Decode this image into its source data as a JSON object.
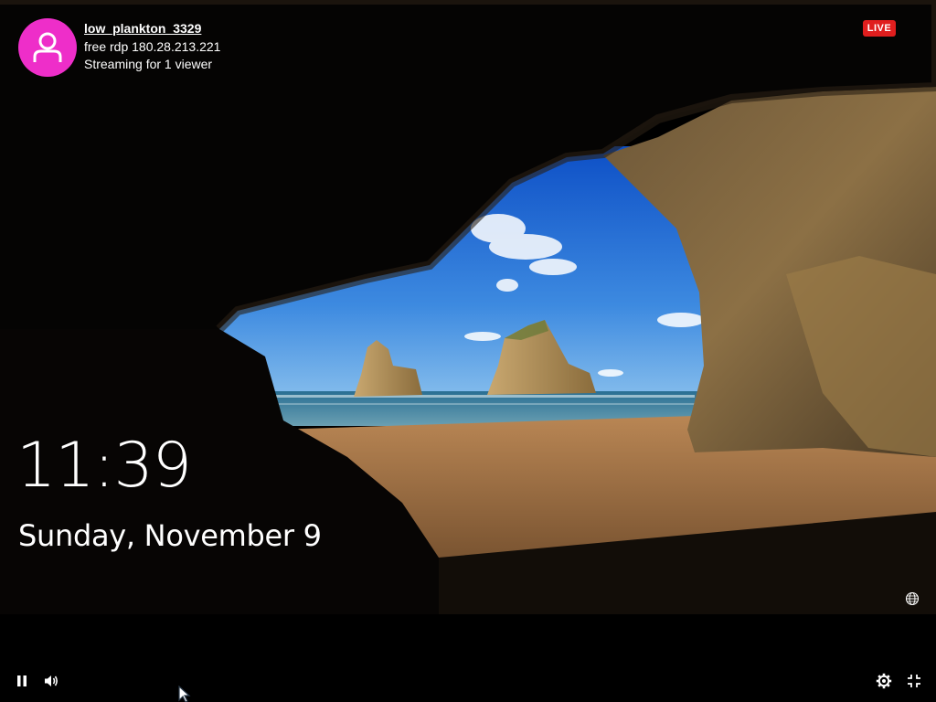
{
  "stream": {
    "streamer_name": "low_plankton_3329",
    "title": "free rdp 180.28.213.221",
    "viewer_text": "Streaming for 1 viewer",
    "live_label": "LIVE",
    "avatar_color": "#ee2ec9",
    "avatar_icon": "user-icon"
  },
  "lockscreen": {
    "time": "11:39",
    "date": "Sunday, November 9",
    "network_icon": "globe-icon"
  },
  "controls": {
    "left": [
      {
        "name": "pause-icon"
      },
      {
        "name": "volume-icon"
      }
    ],
    "right": [
      {
        "name": "gear-icon"
      },
      {
        "name": "exit-fullscreen-icon"
      }
    ]
  },
  "colors": {
    "live_badge": "#e01e1e",
    "background": "#000000"
  }
}
